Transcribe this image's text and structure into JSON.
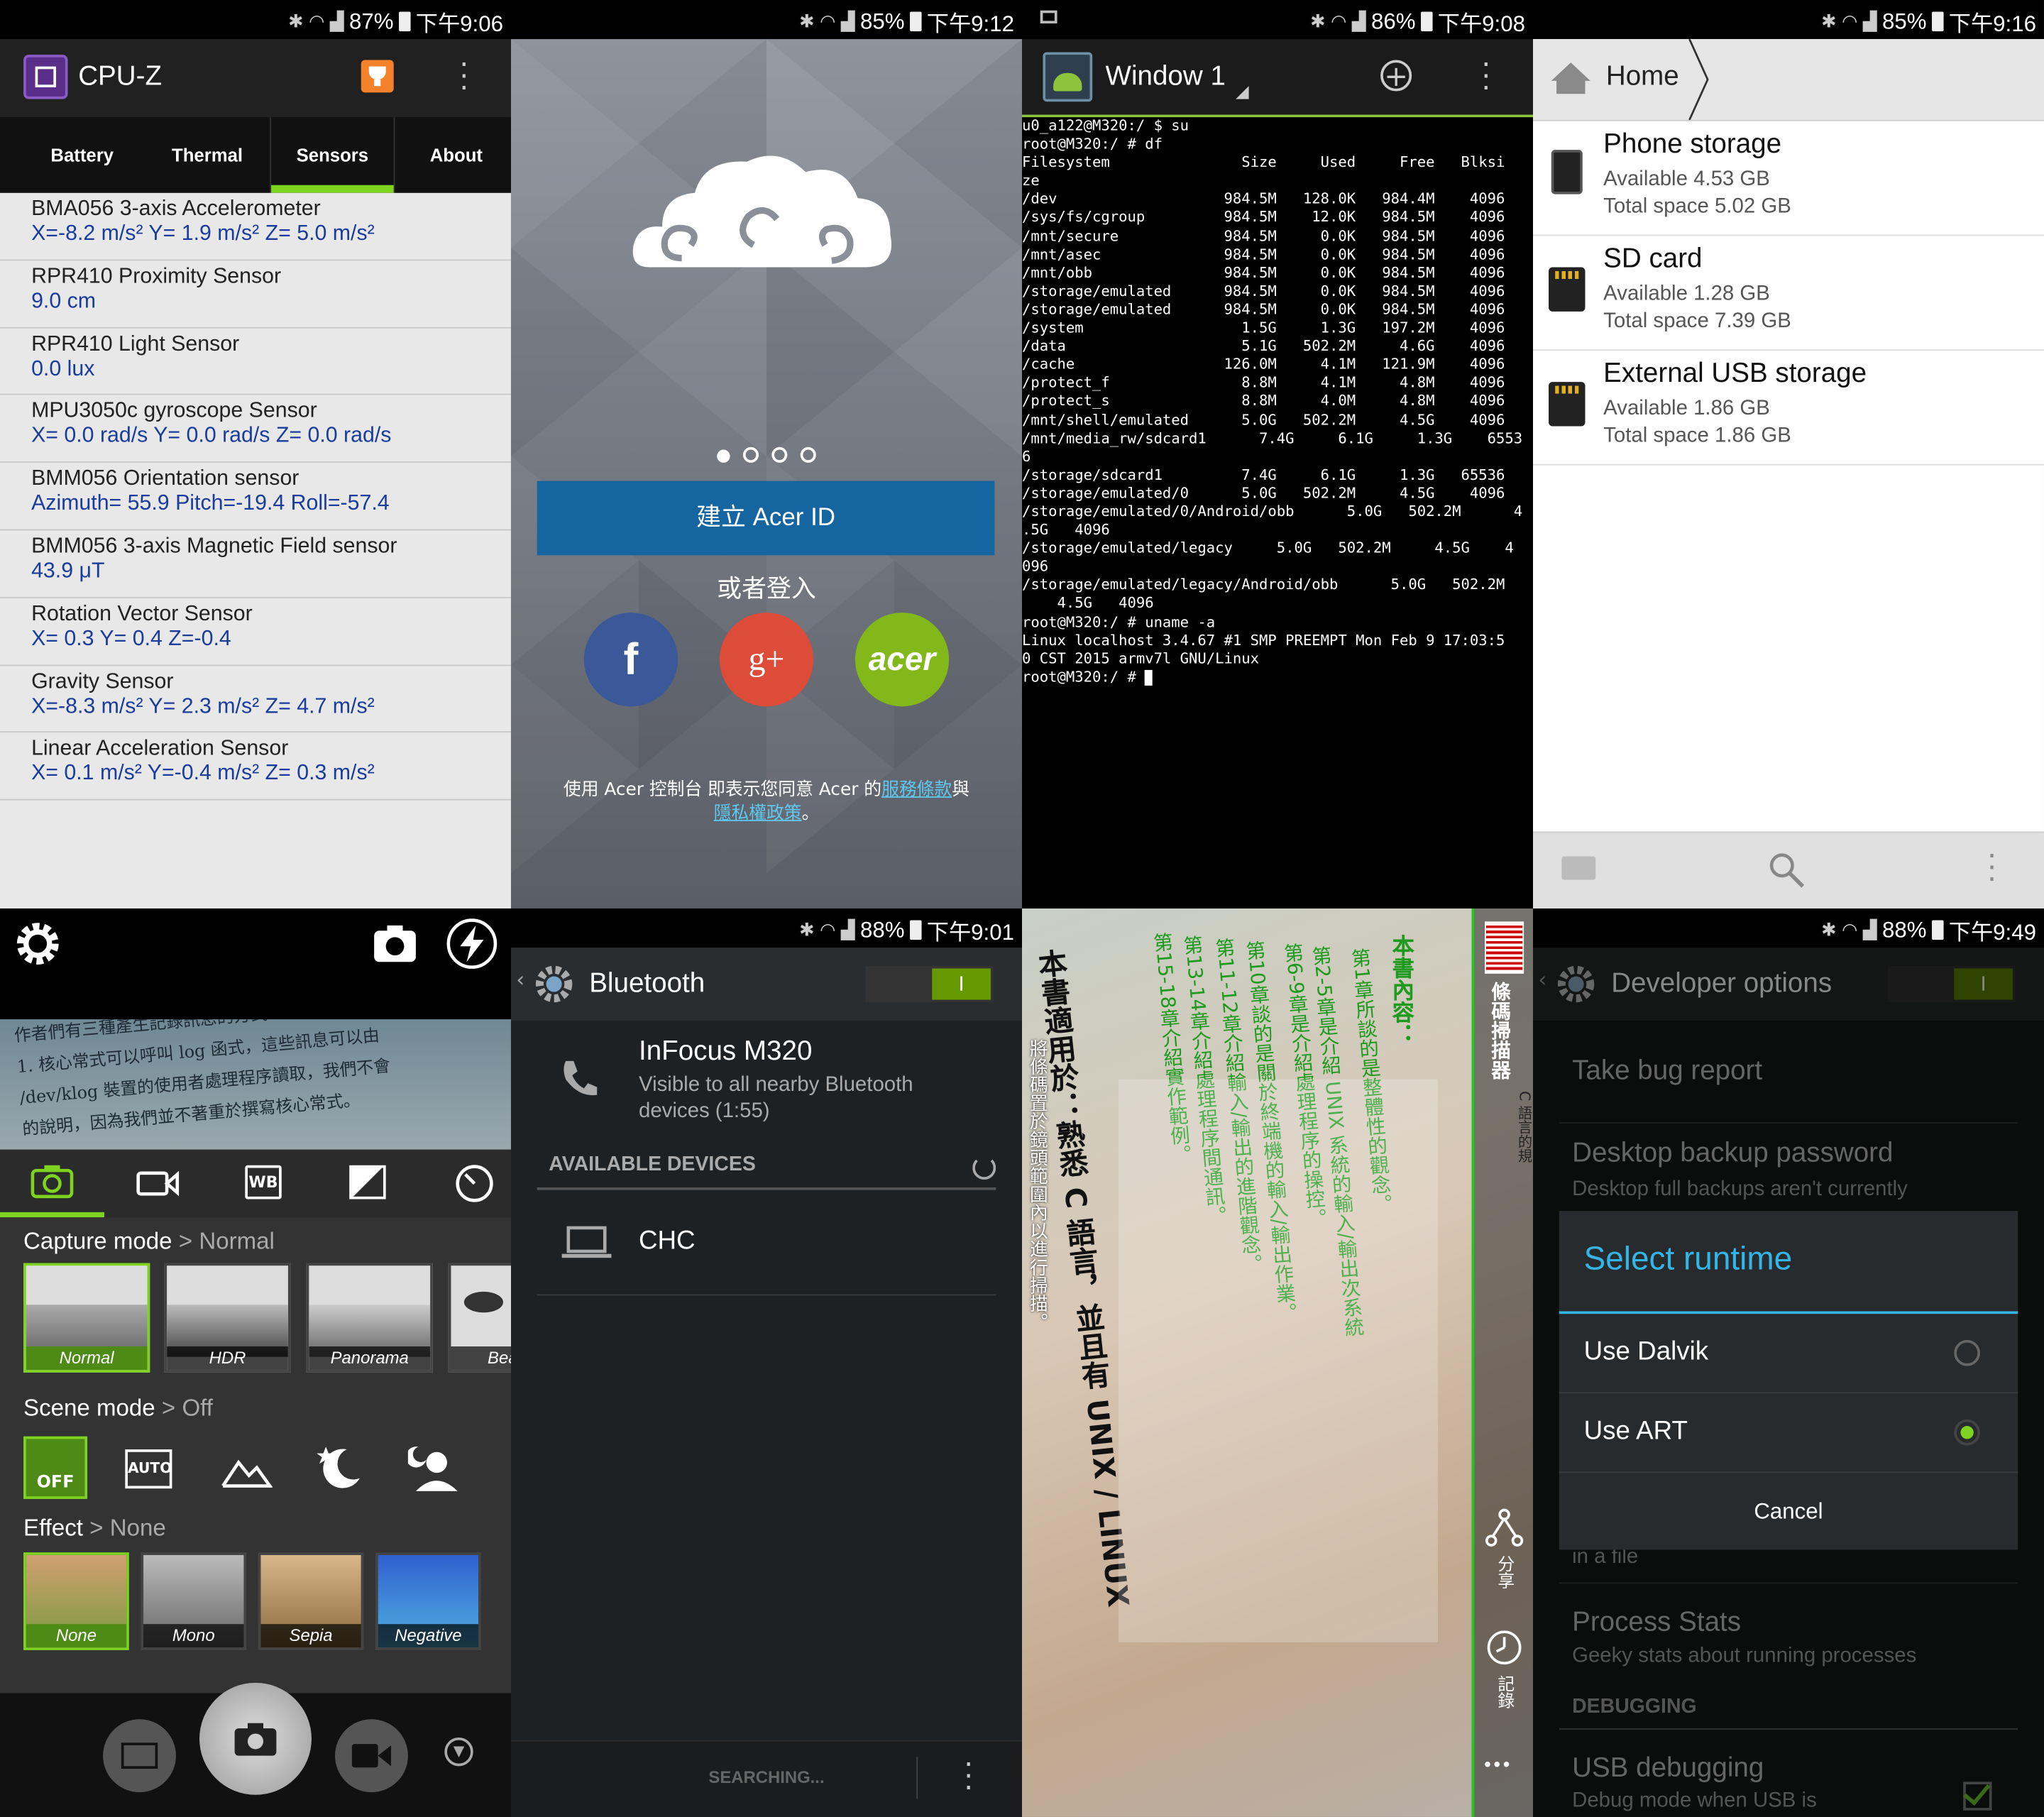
{
  "cpuz": {
    "status": {
      "battery": "87%",
      "time": "下午9:06"
    },
    "title": "CPU-Z",
    "tabs": [
      "Battery",
      "Thermal",
      "Sensors",
      "About"
    ],
    "sensors": [
      {
        "name": "BMA056 3-axis Accelerometer",
        "value": "X=-8.2 m/s²   Y= 1.9 m/s²   Z= 5.0 m/s²"
      },
      {
        "name": "RPR410  Proximity Sensor",
        "value": "9.0 cm"
      },
      {
        "name": "RPR410 Light Sensor",
        "value": "0.0 lux"
      },
      {
        "name": "MPU3050c gyroscope Sensor",
        "value": "X= 0.0 rad/s    Y= 0.0 rad/s    Z= 0.0 rad/s"
      },
      {
        "name": "BMM056 Orientation sensor",
        "value": "Azimuth= 55.9    Pitch=-19.4    Roll=-57.4"
      },
      {
        "name": "BMM056 3-axis Magnetic Field sensor",
        "value": "43.9 μT"
      },
      {
        "name": "Rotation Vector Sensor",
        "value": "X= 0.3    Y= 0.4    Z=-0.4"
      },
      {
        "name": "Gravity Sensor",
        "value": "X=-8.3 m/s²   Y= 2.3 m/s²   Z= 4.7 m/s²"
      },
      {
        "name": "Linear Acceleration Sensor",
        "value": "X= 0.1 m/s²   Y=-0.4 m/s²   Z= 0.3 m/s²"
      }
    ]
  },
  "acer": {
    "status": {
      "battery": "85%",
      "time": "下午9:12"
    },
    "create_button": "建立 Acer ID",
    "or_login": "或者登入",
    "social": [
      "f",
      "g+",
      "acer"
    ],
    "terms_prefix": "使用 Acer 控制台 即表示您同意 Acer 的",
    "terms_link": "服務條款",
    "terms_and": "與",
    "privacy_link": "隱私權政策",
    "terms_end": "。"
  },
  "terminal": {
    "status": {
      "battery": "86%",
      "time": "下午9:08"
    },
    "title": "Window 1",
    "lines": [
      "u0_a122@M320:/ $ su",
      "root@M320:/ # df",
      "Filesystem               Size     Used     Free   Blksi",
      "ze",
      "/dev                   984.5M   128.0K   984.4M    4096",
      "/sys/fs/cgroup         984.5M    12.0K   984.5M    4096",
      "/mnt/secure            984.5M     0.0K   984.5M    4096",
      "/mnt/asec              984.5M     0.0K   984.5M    4096",
      "/mnt/obb               984.5M     0.0K   984.5M    4096",
      "/storage/emulated      984.5M     0.0K   984.5M    4096",
      "/storage/emulated      984.5M     0.0K   984.5M    4096",
      "/system                  1.5G     1.3G   197.2M    4096",
      "/data                    5.1G   502.2M     4.6G    4096",
      "/cache                 126.0M     4.1M   121.9M    4096",
      "/protect_f               8.8M     4.1M     4.8M    4096",
      "/protect_s               8.8M     4.0M     4.8M    4096",
      "/mnt/shell/emulated      5.0G   502.2M     4.5G    4096",
      "/mnt/media_rw/sdcard1      7.4G     6.1G     1.3G    6553",
      "6",
      "/storage/sdcard1         7.4G     6.1G     1.3G   65536",
      "/storage/emulated/0      5.0G   502.2M     4.5G    4096",
      "/storage/emulated/0/Android/obb      5.0G   502.2M      4",
      ".5G   4096",
      "/storage/emulated/legacy     5.0G   502.2M     4.5G    4",
      "096",
      "/storage/emulated/legacy/Android/obb      5.0G   502.2M",
      "    4.5G   4096",
      "root@M320:/ # uname -a",
      "Linux localhost 3.4.67 #1 SMP PREEMPT Mon Feb 9 17:03:5",
      "0 CST 2015 armv7l GNU/Linux",
      "root@M320:/ # "
    ]
  },
  "storage": {
    "status": {
      "battery": "85%",
      "time": "下午9:16"
    },
    "breadcrumb": "Home",
    "items": [
      {
        "name": "Phone storage",
        "available": "Available 4.53 GB",
        "total": "Total space 5.02 GB"
      },
      {
        "name": "SD card",
        "available": "Available 1.28 GB",
        "total": "Total space 7.39 GB"
      },
      {
        "name": "External USB storage",
        "available": "Available 1.86 GB",
        "total": "Total space 1.86 GB"
      }
    ]
  },
  "camera": {
    "page_lines": [
      "作者們有三種產生記錄訊息的方式：",
      "1. 核心常式可以呼叫 log 函式，這些訊息可以由",
      "/dev/klog 裝置的使用者處理程序讀取，我們不會",
      "的說明，因為我們並不著重於撰寫核心常式。"
    ],
    "capture_label": "Capture mode",
    "capture_value": "Normal",
    "capture_modes": [
      "Normal",
      "HDR",
      "Panorama",
      "Beauti"
    ],
    "scene_label": "Scene mode",
    "scene_value": "Off",
    "scene_off": "OFF",
    "scene_auto": "AUTO",
    "effect_label": "Effect",
    "effect_value": "None",
    "effects": [
      "None",
      "Mono",
      "Sepia",
      "Negative"
    ],
    "sep": ">",
    "wb": "WB"
  },
  "bluetooth": {
    "status": {
      "battery": "88%",
      "time": "下午9:01"
    },
    "title": "Bluetooth",
    "toggle": "I",
    "device_name": "InFocus M320",
    "device_sub": "Visible to all nearby Bluetooth devices (1:55)",
    "available_header": "AVAILABLE DEVICES",
    "devices": [
      "CHC"
    ],
    "searching": "SEARCHING..."
  },
  "scanner": {
    "side_title": "條碼掃描器",
    "side_sub": "C 語言的規",
    "share": "分享",
    "history": "記錄",
    "overflow": "•••",
    "hint": "將條碼置於鏡頭範圍內以進行掃描。",
    "page_heading": "本書內容：",
    "page_lines": [
      "第1章所談的是整體性的觀念。",
      "第2-5章是介紹 UNIX 系統的輸入/輸出次系統",
      "第6-9章是介紹處理程序的操控。",
      "第10章談的是關於終端機的輸入/輸出作業。",
      "第11-12章介紹輸入/輸出的進階觀念。",
      "第13-14章介紹處理程序間通訊。",
      "第15-18章介紹實作範例。"
    ],
    "big_lines": [
      "本書適用於：熟悉 C 語言，並且有 UNIX / LINUX"
    ]
  },
  "devopt": {
    "status": {
      "battery": "88%",
      "time": "下午9:49"
    },
    "title": "Developer options",
    "toggle": "I",
    "bug_report": "Take bug report",
    "backup_title": "Desktop backup password",
    "backup_sub": "Desktop full backups aren't currently",
    "dialog_title": "Select runtime",
    "options": [
      "Use Dalvik",
      "Use ART"
    ],
    "cancel": "Cancel",
    "in_file": "in a file",
    "process_title": "Process Stats",
    "process_sub": "Geeky stats about running processes",
    "debugging": "DEBUGGING",
    "usb_title": "USB debugging",
    "usb_sub": "Debug mode when USB is"
  },
  "colors": {
    "accent": "#33b5e5",
    "cpuz_tab": "#7ed321",
    "acer_blue": "#1565a0",
    "fb": "#3b5998",
    "gplus": "#dd4b39",
    "acer_green": "#83b81a",
    "term_green": "#8cc43c",
    "scan_green": "#1ec81e"
  },
  "icons": [
    "cpuz-icon",
    "trophy-icon",
    "overflow-icon",
    "add-circle-icon",
    "terminal-icon",
    "home-icon",
    "sd-card-icon",
    "phone-icon",
    "new-folder-icon",
    "search-icon",
    "gear-icon",
    "camera-switch-icon",
    "flash-icon",
    "camera-icon",
    "video-icon",
    "wb-icon",
    "exposure-icon",
    "timer-icon",
    "panorama-icon",
    "chevron-down-icon",
    "bluetooth-settings-icon",
    "phone-handset-icon",
    "laptop-icon",
    "barcode-icon",
    "share-icon",
    "history-icon",
    "check-icon"
  ]
}
